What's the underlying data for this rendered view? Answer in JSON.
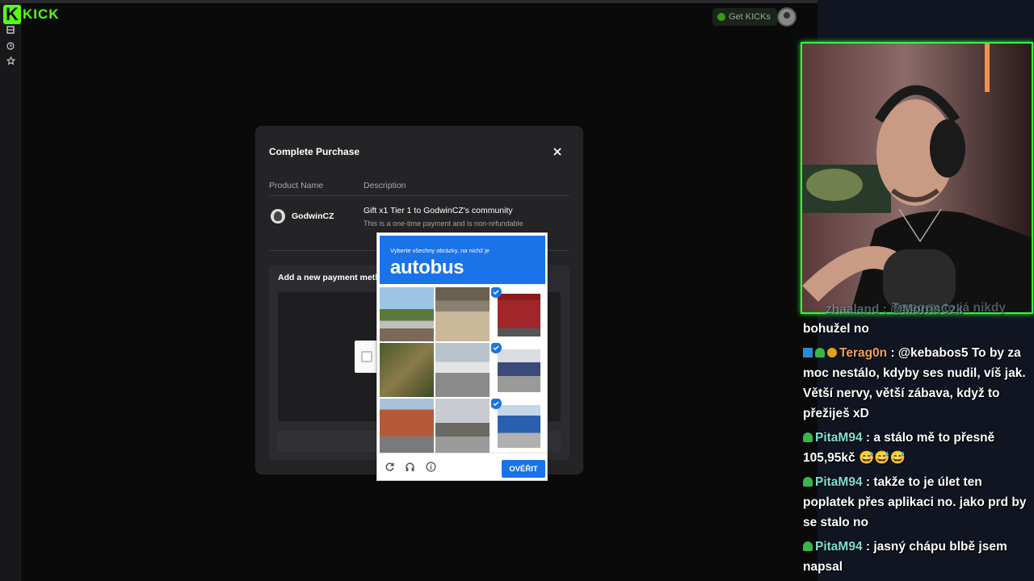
{
  "app": {
    "logo_text": "KICK",
    "get_kicks_label": "Get KICKs",
    "brand_color": "#53fc18"
  },
  "sidebar": {
    "icons": [
      "browse-icon",
      "history-icon",
      "star-icon"
    ]
  },
  "modal": {
    "title": "Complete Purchase",
    "close_icon": "close-icon",
    "columns": {
      "product": "Product Name",
      "description": "Description"
    },
    "product_name": "GodwinCZ",
    "description": "Gift x1 Tier 1 to GodwinCZ's community",
    "note": "This is a one-time payment and is non-refundable",
    "payment_label": "Add a new payment meth"
  },
  "captcha": {
    "instruction": "Vyberte všechny obrázky, na nichž je",
    "target": "autobus",
    "verify_label": "OVĚŘIT",
    "accent": "#1a73e8",
    "tiles_selected": [
      false,
      false,
      true,
      false,
      false,
      true,
      false,
      false,
      true
    ],
    "footer_icons": [
      "reload-icon",
      "audio-icon",
      "info-icon"
    ]
  },
  "chat": {
    "messages": [
      {
        "user": "",
        "text": "bohužel no",
        "color": "#ffffff"
      },
      {
        "user": "Terag0n",
        "text": " : @kebabos5 To by za moc nestálo, kdyby ses nudil, víš jak. Větší nervy, větší zábava, když to přežiješ xD",
        "color": "#f0a35a"
      },
      {
        "user": "PitaM94",
        "text": " : a stálo mě to přesně 105,95kč 😅😅😅",
        "color": "#7ee0d0"
      },
      {
        "user": "PitaM94",
        "text": " : takže to je úlet ten poplatek přes aplikaci no. jako prd by se stalo no",
        "color": "#7ee0d0"
      },
      {
        "user": "PitaM94",
        "text": " : jasný chápu blbě jsem napsal",
        "color": "#7ee0d0"
      }
    ],
    "faded_line_1": "Teragon to já nikdy",
    "faded_line_2": "zhaaland : @MorrisCzk"
  }
}
